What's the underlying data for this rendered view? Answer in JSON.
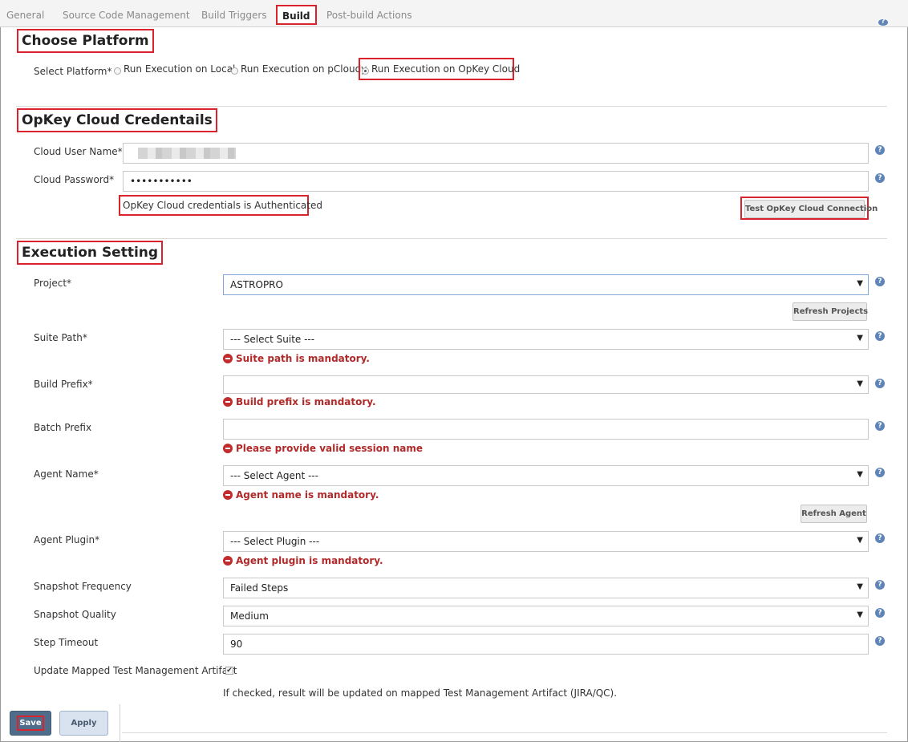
{
  "tabs": [
    {
      "label": "General",
      "active": false
    },
    {
      "label": "Source Code Management",
      "active": false
    },
    {
      "label": "Build Triggers",
      "active": false
    },
    {
      "label": "Build",
      "active": true
    },
    {
      "label": "Post-build Actions",
      "active": false
    }
  ],
  "platform": {
    "title": "Choose Platform",
    "label": "Select Platform*",
    "options": [
      {
        "label": "Run Execution on Local",
        "checked": false
      },
      {
        "label": "Run Execution on pCloudy",
        "checked": false
      },
      {
        "label": "Run Execution on OpKey Cloud",
        "checked": true
      }
    ]
  },
  "credentials": {
    "title": "OpKey Cloud Credentails",
    "username_label": "Cloud User Name*",
    "password_label": "Cloud Password*",
    "password_value": "•••••••••••",
    "status": "OpKey Cloud credentials is Authenticated",
    "test_button": "Test OpKey Cloud Connection"
  },
  "execution": {
    "title": "Execution Setting",
    "project": {
      "label": "Project*",
      "value": "ASTROPRO",
      "refresh_button": "Refresh Projects"
    },
    "suite_path": {
      "label": "Suite Path*",
      "value": "--- Select Suite ---",
      "error": "Suite path is mandatory."
    },
    "build_prefix": {
      "label": "Build Prefix*",
      "value": "",
      "error": "Build prefix is mandatory."
    },
    "batch_prefix": {
      "label": "Batch Prefix",
      "value": "",
      "error": "Please provide valid session name"
    },
    "agent_name": {
      "label": "Agent Name*",
      "value": "--- Select Agent ---",
      "error": "Agent name is mandatory.",
      "refresh_button": "Refresh Agent"
    },
    "agent_plugin": {
      "label": "Agent Plugin*",
      "value": "--- Select Plugin ---",
      "error": "Agent plugin is mandatory."
    },
    "snapshot_frequency": {
      "label": "Snapshot Frequency",
      "value": "Failed Steps"
    },
    "snapshot_quality": {
      "label": "Snapshot Quality",
      "value": "Medium"
    },
    "step_timeout": {
      "label": "Step Timeout",
      "value": "90"
    },
    "update_artifact": {
      "label": "Update Mapped Test Management Artifact",
      "checked": true,
      "checkmark": "✔",
      "hint": "If checked, result will be updated on mapped Test Management Artifact (JIRA/QC)."
    }
  },
  "footer": {
    "save_label": "Save",
    "apply_label": "Apply"
  },
  "icons": {
    "help": "?",
    "dropdown": "▼"
  },
  "colors": {
    "highlight": "#d9232d",
    "error": "#b02a2a",
    "help": "#5f84b8",
    "save": "#4f6d8a"
  }
}
